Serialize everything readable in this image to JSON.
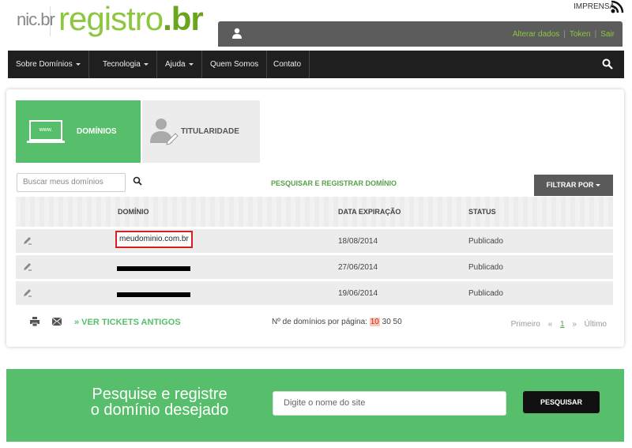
{
  "header": {
    "logo_nic": "nic.br",
    "logo_registro": "registro",
    "logo_br": ".br",
    "imprensa": "IMPRENSA",
    "user_links": [
      "Alterar dados",
      "Token",
      "Sair"
    ]
  },
  "nav": {
    "items": [
      {
        "label": "Sobre Domínios",
        "has_dropdown": true
      },
      {
        "label": "Tecnologia",
        "has_dropdown": true
      },
      {
        "label": "Ajuda",
        "has_dropdown": true
      },
      {
        "label": "Quem Somos",
        "has_dropdown": false
      },
      {
        "label": "Contato",
        "has_dropdown": false
      }
    ]
  },
  "tabs": {
    "dominios": "DOMÍNIOS",
    "titularidade": "TITULARIDADE",
    "www_label": "www."
  },
  "toolbar": {
    "search_placeholder": "Buscar meus domínios",
    "pesquisar_link": "PESQUISAR E REGISTRAR DOMÍNIO",
    "filtrar": "FILTRAR POR"
  },
  "table": {
    "headers": [
      "DOMÍNIO",
      "DATA EXPIRAÇÃO",
      "STATUS"
    ],
    "rows": [
      {
        "domain": "meudominio.com.br",
        "expiration": "18/08/2014",
        "status": "Publicado",
        "redacted": false
      },
      {
        "domain": "",
        "expiration": "27/06/2014",
        "status": "Publicado",
        "redacted": true
      },
      {
        "domain": "",
        "expiration": "19/06/2014",
        "status": "Publicado",
        "redacted": true
      }
    ]
  },
  "footer": {
    "tickets": "» VER TICKETS ANTIGOS",
    "perpage_label": "Nº de domínios por página:",
    "perpage_options": [
      "10",
      "30",
      "50"
    ],
    "perpage_selected": "10",
    "pager": {
      "first": "Primeiro",
      "prev": "«",
      "current": "1",
      "next": "»",
      "last": "Último"
    }
  },
  "banner": {
    "text_line1": "Pesquise e registre",
    "text_line2": "o domínio desejado",
    "input_placeholder": "Digite o nome do site",
    "button": "PESQUISAR"
  },
  "colors": {
    "green": "#57bf6b",
    "dark_nav": "#1f1f1f",
    "highlight_red": "#d9201f"
  }
}
